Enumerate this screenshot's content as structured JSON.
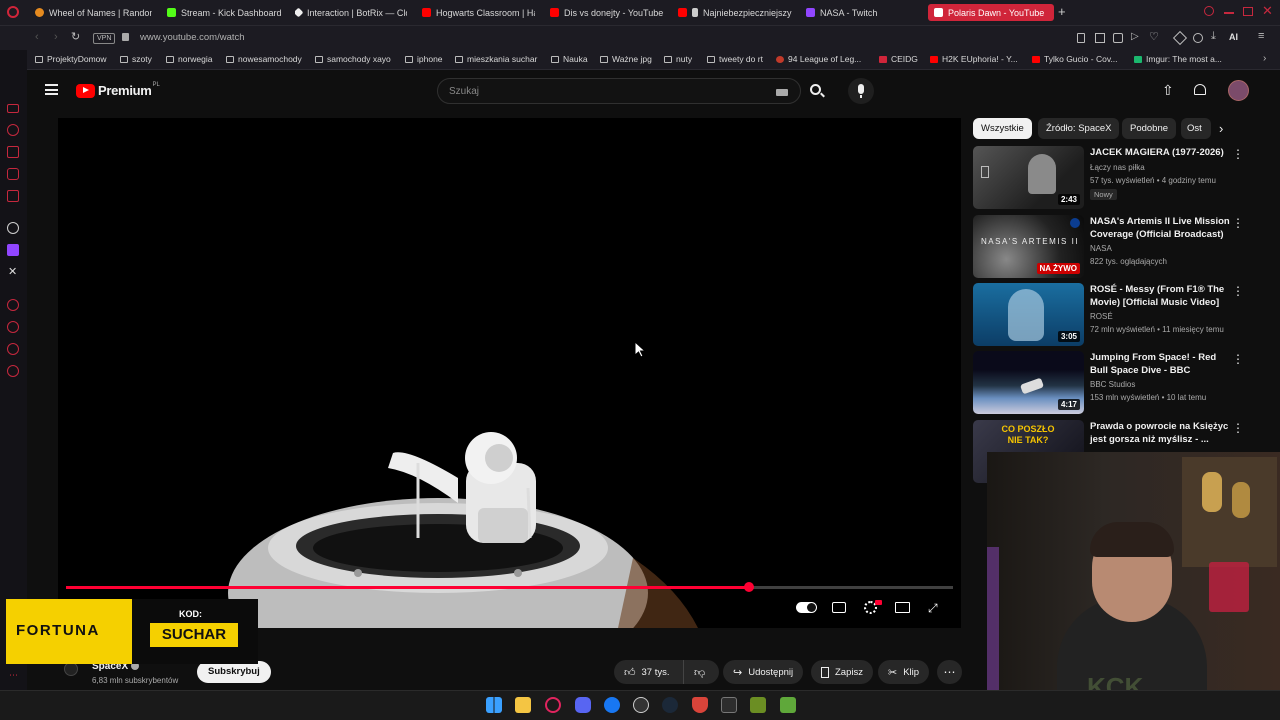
{
  "browser": {
    "tabs": [
      {
        "label": "Wheel of Names | Random",
        "color": "#e58a1f"
      },
      {
        "label": "Stream - Kick Dashboard",
        "color": "#53fc18"
      },
      {
        "label": "Interaction | BotRix — Clo",
        "color": "#eeeeee"
      },
      {
        "label": "Hogwarts Classroom | Ha",
        "color": "#ff0000"
      },
      {
        "label": "Dis vs donejty - YouTube",
        "color": "#ff0000"
      },
      {
        "label": "Najniebezpieczniejszy",
        "color": "#ff0000"
      },
      {
        "label": "NASA - Twitch",
        "color": "#9146ff"
      },
      {
        "label": "Polaris Dawn - YouTube",
        "color": "#ffffff"
      }
    ],
    "vpn_label": "VPN",
    "url": "www.youtube.com/watch",
    "ai_label": "AI",
    "bookmarks": [
      "ProjektyDomow",
      "szoty",
      "norwegia",
      "nowesamochody",
      "samochody xayo",
      "iphone",
      "mieszkania suchar",
      "Nauka",
      "Ważne jpg",
      "nuty",
      "tweety do rt",
      "94 League of Leg...",
      "CEIDG",
      "H2K EUphoria! - Y...",
      "Tylko Gucio - Cov...",
      "Imgur: The most a..."
    ]
  },
  "youtube": {
    "logo_text": "Premium",
    "logo_region": "PL",
    "search_placeholder": "Szukaj",
    "chips": [
      "Wszystkie",
      "Źródło: SpaceX",
      "Podobne",
      "Ost"
    ],
    "recommendations": [
      {
        "title": "JACEK MAGIERA (1977-2026)",
        "channel": "Łączy nas piłka",
        "meta": "57 tys. wyświetleń • 4 godziny temu",
        "badge": "Nowy",
        "duration": "2:43"
      },
      {
        "title": "NASA's Artemis II Live Mission Coverage (Official Broadcast)",
        "channel": "NASA",
        "meta": "822 tys. oglądających",
        "live": "NA ŻYWO",
        "thumb_text": "NASA'S ARTEMIS II"
      },
      {
        "title": "ROSÉ - Messy (From F1® The Movie) [Official Music Video]",
        "channel": "ROSÉ",
        "meta": "72 mln wyświetleń • 11 miesięcy temu",
        "duration": "3:05"
      },
      {
        "title": "Jumping From Space! - Red Bull Space Dive - BBC",
        "channel": "BBC Studios",
        "meta": "153 mln wyświetleń • 10 lat temu",
        "duration": "4:17"
      },
      {
        "title": "Prawda o powrocie na Księżyc jest gorsza niż myślisz - ...",
        "thumb_text": "CO POSZŁO NIE TAK?"
      }
    ],
    "video": {
      "progress": 0.77
    },
    "channel": {
      "name": "SpaceX",
      "subs": "6,83 mln subskrybentów",
      "subscribe": "Subskrybuj"
    },
    "actions": {
      "likes": "37 tys.",
      "share": "Udostępnij",
      "save": "Zapisz",
      "clip": "Klip"
    }
  },
  "ad": {
    "brand": "FORTUNA",
    "code_label": "KOD:",
    "code": "SUCHAR"
  },
  "webcam": {
    "watermark": "KCK"
  }
}
